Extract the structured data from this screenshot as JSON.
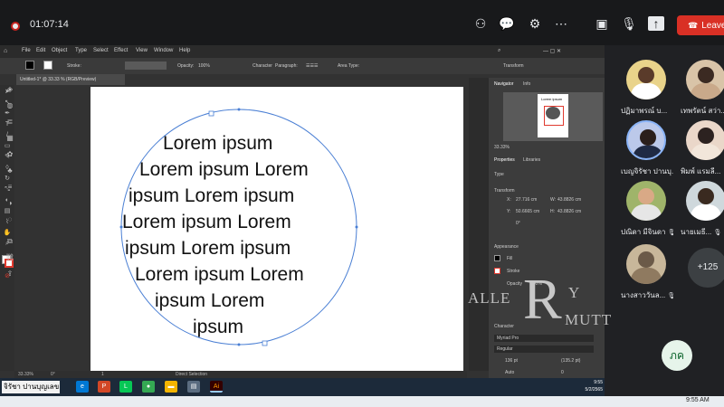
{
  "meeting": {
    "timer": "01:07:14",
    "leave_label": "Leave",
    "participant_more": "+125",
    "self_initials": "ภค",
    "participants": [
      {
        "name": "ปฏิมาพรณ์ บ..."
      },
      {
        "name": "เทพรัตน์ สว่า..."
      },
      {
        "name": "เบญจิรัชา ปานบุ..."
      },
      {
        "name": "พิมพ์ แรมลี..."
      },
      {
        "name": "ปณิดา มีจินดา"
      },
      {
        "name": "นายเมธี..."
      },
      {
        "name": "นางสาววันล..."
      }
    ]
  },
  "illustrator": {
    "menu": [
      "File",
      "Edit",
      "Object",
      "Type",
      "Select",
      "Effect",
      "View",
      "Window",
      "Help"
    ],
    "control": {
      "stroke_label": "Stroke:",
      "opacity_label": "Opacity:",
      "opacity_value": "100%",
      "character_label": "Character",
      "paragraph_label": "Paragraph:",
      "area_type_label": "Area Type:",
      "transform_label": "Transform"
    },
    "doc_tab": "Untitled-1* @ 33.33 % (RGB/Preview)",
    "status": {
      "zoom": "33.33%",
      "angle": "0°",
      "page": "1",
      "tool": "Direct Selection"
    },
    "navigator": {
      "tab1": "Navigator",
      "tab2": "Info",
      "zoom": "33.33%",
      "page_title": "Lorem ipsum"
    },
    "properties": {
      "tab1": "Properties",
      "tab2": "Libraries",
      "section_type": "Type",
      "section_transform": "Transform",
      "x_label": "X:",
      "x_value": "27.716 cm",
      "y_label": "Y:",
      "y_value": "50.6665 cm",
      "w_label": "W:",
      "w_value": "43.8826 cm",
      "h_label": "H:",
      "h_value": "43.8826 cm",
      "rotate": "0°",
      "section_appearance": "Appearance",
      "fill_label": "Fill",
      "stroke_label": "Stroke",
      "opacity_label": "Opacity",
      "opacity_value": "100%",
      "section_character": "Character",
      "font_family": "Myriad Pro",
      "font_style": "Regular",
      "font_size": "136 pt",
      "leading": "(135.2 pt)",
      "tracking": "0",
      "kerning": "Auto"
    },
    "lorem_lines": [
      "Lorem ipsum",
      "Lorem ipsum Lorem",
      "ipsum Lorem ipsum",
      "Lorem ipsum Lorem",
      "ipsum Lorem ipsum",
      "Lorem ipsum Lorem",
      "ipsum Lorem",
      "ipsum"
    ]
  },
  "watermark": {
    "left": "ALLE",
    "letter": "R",
    "right_top": "Y",
    "right_bottom": "MUTT"
  },
  "taskbar": {
    "user_label": "จิรัชา ปานบุญเลข",
    "time": "9:55",
    "date": "5/2/2565"
  },
  "system_bar": {
    "time": "9:55 AM"
  },
  "colors": {
    "leave": "#d93025",
    "accent_red": "#e03a2f",
    "meet_bg": "#202124"
  }
}
